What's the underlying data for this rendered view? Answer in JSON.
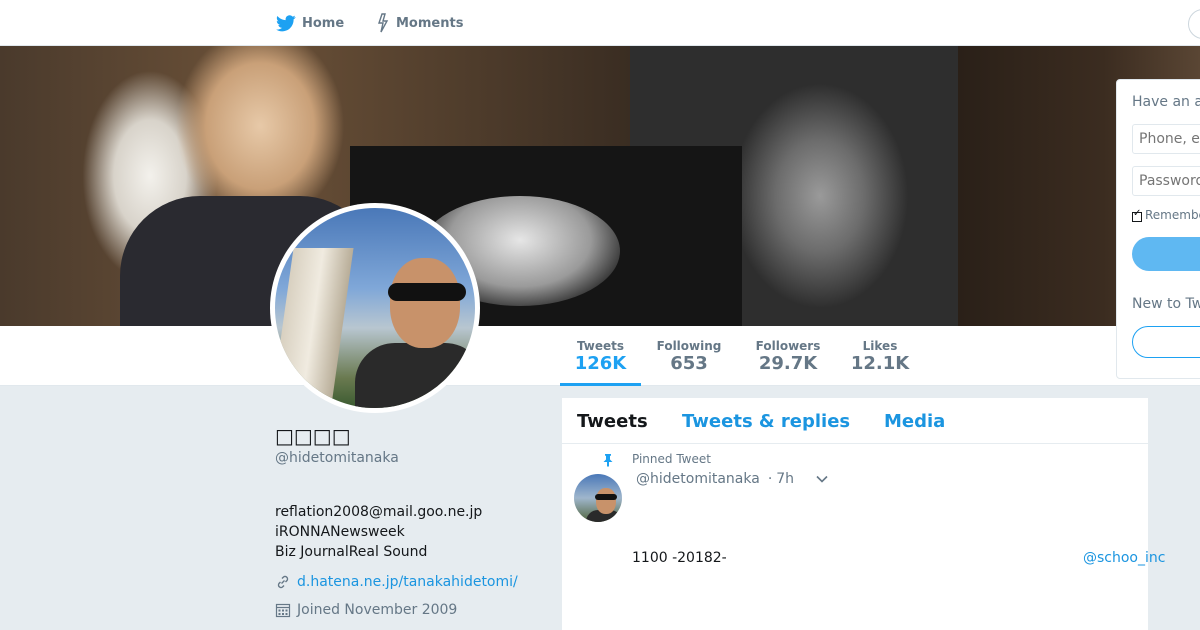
{
  "nav": {
    "home_label": "Home",
    "moments_label": "Moments"
  },
  "profile": {
    "display_name": "□□□□",
    "handle": "@hidetomitanaka",
    "bio_lines": [
      "reflation2008@mail.goo.ne.jp",
      "iRONNANewsweek",
      "Biz JournalReal Sound"
    ],
    "link": "d.hatena.ne.jp/tanakahidetomi/",
    "joined": "Joined November 2009"
  },
  "stats": [
    {
      "label": "Tweets",
      "value": "126K",
      "active": true
    },
    {
      "label": "Following",
      "value": "653",
      "active": false
    },
    {
      "label": "Followers",
      "value": "29.7K",
      "active": false
    },
    {
      "label": "Likes",
      "value": "12.1K",
      "active": false
    }
  ],
  "timeline": {
    "tabs": [
      "Tweets",
      "Tweets & replies",
      "Media"
    ],
    "active_tab": "Tweets",
    "pinned_label": "Pinned Tweet",
    "tweet": {
      "handle": "@hidetomitanaka",
      "separator": "·",
      "time": "7h",
      "text": "1100 -20182-",
      "mention": "@schoo_inc"
    }
  },
  "login": {
    "title": "Have an account?",
    "phone_placeholder": "Phone, email or username",
    "password_placeholder": "Password",
    "remember_label": "Remember me",
    "new_label": "New to Twitter?"
  },
  "colors": {
    "accent": "#1da1f2",
    "link": "#1b95e0",
    "muted": "#657786",
    "background": "#e6ecf0"
  },
  "icons": {
    "home": "twitter-bird-icon",
    "moments": "lightning-icon",
    "link": "link-icon",
    "joined": "calendar-icon",
    "pinned": "pin-icon",
    "caret": "chevron-down-icon"
  }
}
